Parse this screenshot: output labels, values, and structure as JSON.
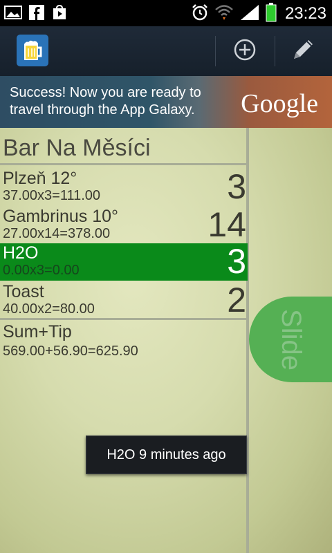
{
  "status_bar": {
    "time": "23:23",
    "icons": [
      "picture-icon",
      "facebook-icon",
      "play-store-icon",
      "alarm-icon",
      "wifi-icon",
      "signal-icon",
      "battery-icon"
    ]
  },
  "action_bar": {
    "app_icon": "beer-mug-icon",
    "actions": [
      "add-icon",
      "edit-pencil-icon"
    ]
  },
  "ad": {
    "text": "Success! Now you are ready to travel through the App Galaxy.",
    "brand": "Google"
  },
  "bar": {
    "title": "Bar Na Měsíci",
    "items": [
      {
        "name": "Plzeň 12°",
        "calc": "37.00x3=111.00",
        "count": "3",
        "selected": false
      },
      {
        "name": "Gambrinus 10°",
        "calc": "27.00x14=378.00",
        "count": "14",
        "selected": false
      },
      {
        "name": "H2O",
        "calc": "0.00x3=0.00",
        "count": "3",
        "selected": true
      },
      {
        "name": "Toast",
        "calc": "40.00x2=80.00",
        "count": "2",
        "selected": false
      }
    ],
    "sum_label": "Sum+Tip",
    "sum_value": "569.00+56.90=625.90"
  },
  "slide_label": "Slide",
  "toast": "H2O 9 minutes ago",
  "colors": {
    "selected_row": "#0a8a1a",
    "slide_button": "#55b054",
    "action_bar": "#1f2a38"
  }
}
